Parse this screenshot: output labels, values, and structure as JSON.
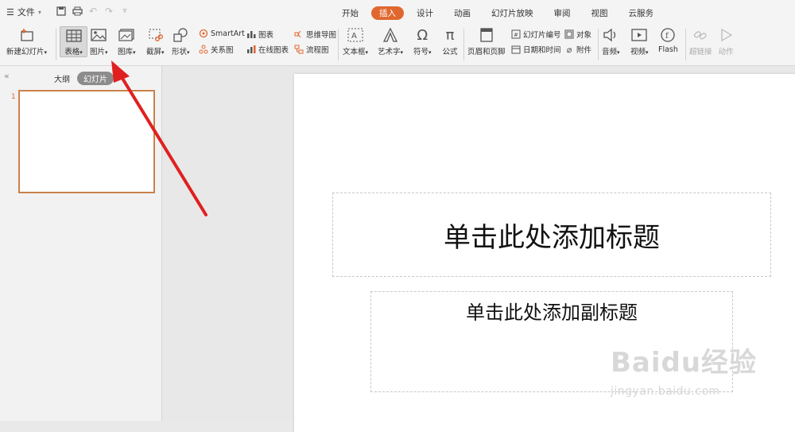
{
  "file_menu": {
    "label": "文件"
  },
  "tabs": [
    {
      "label": "开始",
      "active": false
    },
    {
      "label": "插入",
      "active": true
    },
    {
      "label": "设计",
      "active": false
    },
    {
      "label": "动画",
      "active": false
    },
    {
      "label": "幻灯片放映",
      "active": false
    },
    {
      "label": "审阅",
      "active": false
    },
    {
      "label": "视图",
      "active": false
    },
    {
      "label": "云服务",
      "active": false
    }
  ],
  "ribbon": {
    "new_slide": "新建幻灯片",
    "table": "表格",
    "picture": "图片",
    "gallery": "图库",
    "screenshot": "截屏",
    "shape": "形状",
    "smartart": "SmartArt",
    "relation": "关系图",
    "chart": "图表",
    "online_chart": "在线图表",
    "mindmap": "思维导图",
    "flowchart": "流程图",
    "textbox": "文本框",
    "wordart": "艺术字",
    "symbol": "符号",
    "formula": "公式",
    "header_footer": "页眉和页脚",
    "slide_number": "幻灯片编号",
    "object": "对象",
    "date_time": "日期和时间",
    "attachment": "附件",
    "audio": "音频",
    "video": "视频",
    "flash": "Flash",
    "hyperlink": "超链接",
    "action": "动作"
  },
  "panel": {
    "outline_tab": "大纲",
    "slides_tab": "幻灯片",
    "slide_number": "1"
  },
  "slide": {
    "title_placeholder": "单击此处添加标题",
    "subtitle_placeholder": "单击此处添加副标题"
  },
  "watermark": {
    "logo": "Baidu经验",
    "url": "jingyan.baidu.com"
  },
  "colors": {
    "accent": "#e0672e",
    "arrow": "#e02020"
  }
}
